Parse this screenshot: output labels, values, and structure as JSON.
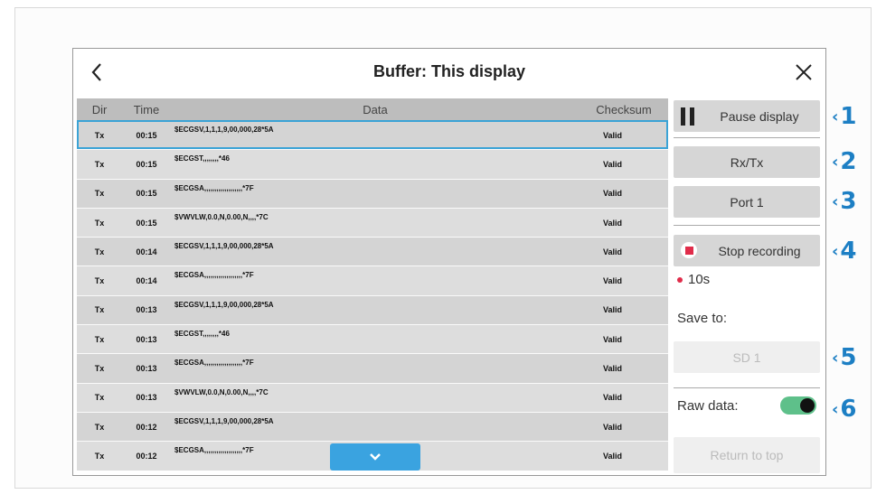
{
  "header": {
    "title": "Buffer: This display"
  },
  "table": {
    "columns": [
      "Dir",
      "Time",
      "Data",
      "Checksum"
    ],
    "rows": [
      {
        "dir": "Tx",
        "time": "00:15",
        "data": "$ECGSV,1,1,1,9,00,000,28*5A",
        "checksum": "Valid"
      },
      {
        "dir": "Tx",
        "time": "00:15",
        "data": "$ECGST,,,,,,,,*46",
        "checksum": "Valid"
      },
      {
        "dir": "Tx",
        "time": "00:15",
        "data": "$ECGSA,,,,,,,,,,,,,,,,,,,*7F",
        "checksum": "Valid"
      },
      {
        "dir": "Tx",
        "time": "00:15",
        "data": "$VWVLW,0.0,N,0.00,N,,,,*7C",
        "checksum": "Valid"
      },
      {
        "dir": "Tx",
        "time": "00:14",
        "data": "$ECGSV,1,1,1,9,00,000,28*5A",
        "checksum": "Valid"
      },
      {
        "dir": "Tx",
        "time": "00:14",
        "data": "$ECGSA,,,,,,,,,,,,,,,,,,,*7F",
        "checksum": "Valid"
      },
      {
        "dir": "Tx",
        "time": "00:13",
        "data": "$ECGSV,1,1,1,9,00,000,28*5A",
        "checksum": "Valid"
      },
      {
        "dir": "Tx",
        "time": "00:13",
        "data": "$ECGST,,,,,,,,*46",
        "checksum": "Valid"
      },
      {
        "dir": "Tx",
        "time": "00:13",
        "data": "$ECGSA,,,,,,,,,,,,,,,,,,,*7F",
        "checksum": "Valid"
      },
      {
        "dir": "Tx",
        "time": "00:13",
        "data": "$VWVLW,0.0,N,0.00,N,,,,*7C",
        "checksum": "Valid"
      },
      {
        "dir": "Tx",
        "time": "00:12",
        "data": "$ECGSV,1,1,1,9,00,000,28*5A",
        "checksum": "Valid"
      },
      {
        "dir": "Tx",
        "time": "00:12",
        "data": "$ECGSA,,,,,,,,,,,,,,,,,,,*7F",
        "checksum": "Valid"
      }
    ]
  },
  "sidebar": {
    "pause_label": "Pause display",
    "rxtx_label": "Rx/Tx",
    "port_label": "Port 1",
    "stop_label": "Stop recording",
    "timer": "10s",
    "save_to_label": "Save to:",
    "save_target": "SD 1",
    "raw_data_label": "Raw data:",
    "raw_data_enabled": true,
    "return_label": "Return to top"
  },
  "callouts": [
    "1",
    "2",
    "3",
    "4",
    "5",
    "6"
  ],
  "colors": {
    "accent": "#3aa3e0",
    "callout": "#1d7fc4",
    "record": "#e02c4a",
    "toggle_on": "#5ec08a"
  },
  "icons": [
    "back-chevron-icon",
    "close-icon",
    "pause-icon",
    "record-stop-icon",
    "chevron-down-icon",
    "callout-arrow-icon"
  ]
}
